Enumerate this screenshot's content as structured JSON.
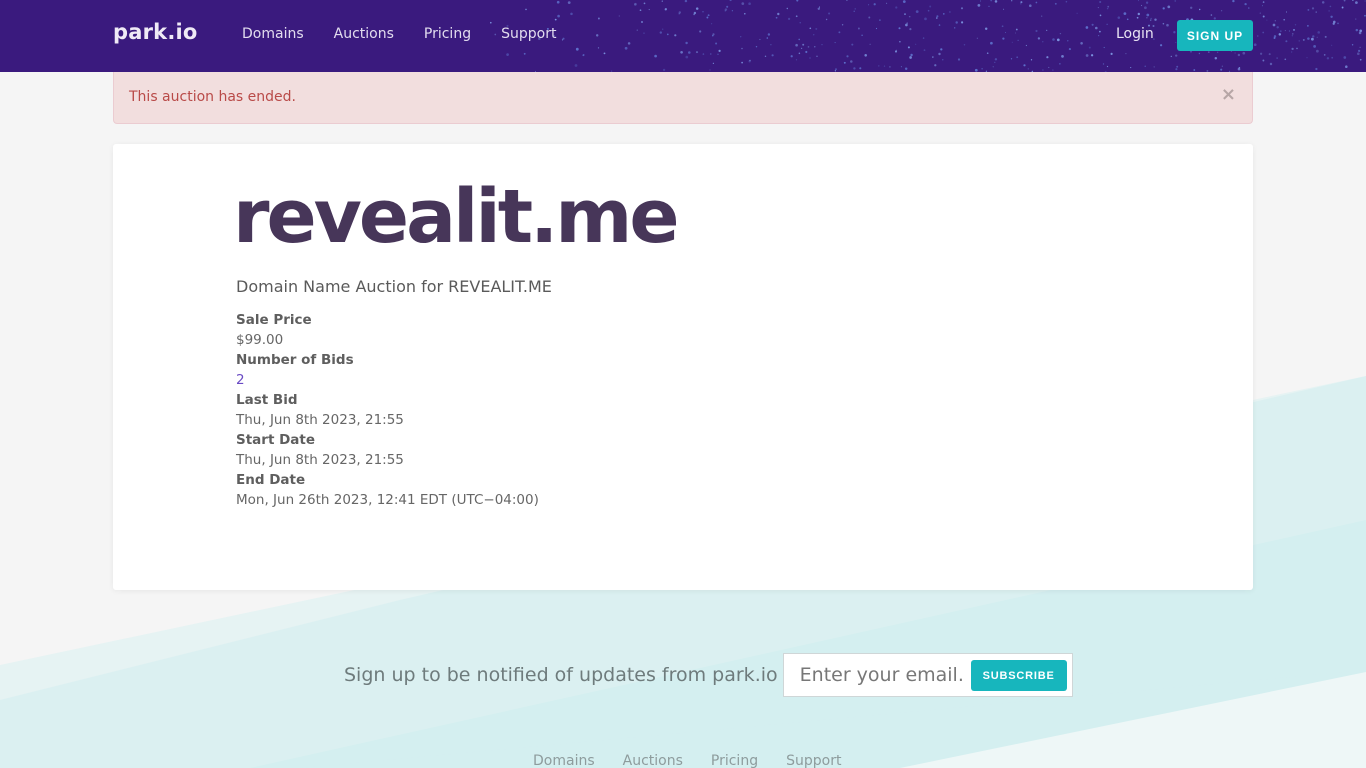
{
  "navbar": {
    "brand": "park.io",
    "links": [
      "Domains",
      "Auctions",
      "Pricing",
      "Support"
    ],
    "login_label": "Login",
    "signup_label": "SIGN UP"
  },
  "alert": {
    "message": "This auction has ended.",
    "close_icon": "×"
  },
  "auction": {
    "domain": "revealit.me",
    "subtitle": "Domain Name Auction for REVEALIT.ME",
    "details": [
      {
        "label": "Sale Price",
        "value": "$99.00"
      },
      {
        "label": "Number of Bids",
        "value": "2"
      },
      {
        "label": "Last Bid",
        "value": "Thu, Jun 8th 2023, 21:55"
      },
      {
        "label": "Start Date",
        "value": "Thu, Jun 8th 2023, 21:55"
      },
      {
        "label": "End Date",
        "value": "Mon, Jun 26th 2023, 12:41 EDT (UTC−04:00)"
      }
    ]
  },
  "subscribe": {
    "text": "Sign up to be notified of updates from park.io",
    "email_placeholder": "Enter your email...",
    "button_label": "SUBSCRIBE"
  },
  "footer": {
    "links": [
      "Domains",
      "Auctions",
      "Pricing",
      "Support"
    ]
  },
  "colors": {
    "nav_bg": "#3a1a7e",
    "accent": "#17b6bd",
    "domain_title": "#473659",
    "alert_bg": "#f2dede",
    "alert_text": "#b94a48",
    "bids_link": "#6a4bc4"
  }
}
